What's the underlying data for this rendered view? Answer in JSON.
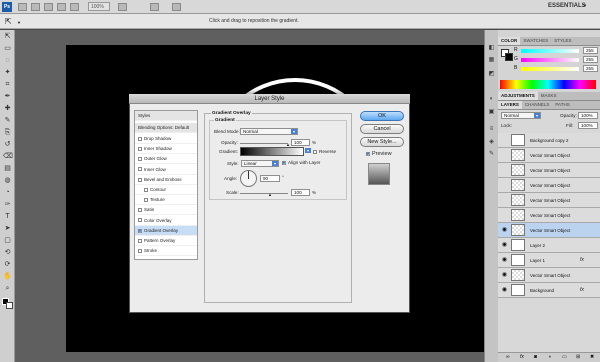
{
  "app": {
    "logo": "Ps",
    "zoom": "100%",
    "workspace": "ESSENTIALS",
    "options_hint": "Click and drag to reposition the gradient."
  },
  "tools": {
    "icons": [
      "move-icon",
      "marquee-icon",
      "lasso-icon",
      "magic-wand-icon",
      "crop-icon",
      "eyedropper-icon",
      "healing-icon",
      "brush-icon",
      "stamp-icon",
      "history-brush-icon",
      "eraser-icon",
      "gradient-icon",
      "blur-icon",
      "dodge-icon",
      "pen-icon",
      "type-icon",
      "path-select-icon",
      "shape-icon",
      "3d-rotate-icon",
      "3d-orbit-icon",
      "hand-icon",
      "zoom-icon"
    ]
  },
  "panels": {
    "color_tabs": [
      "COLOR",
      "SWATCHES",
      "STYLES"
    ],
    "color_labels": [
      "R",
      "G",
      "B"
    ],
    "color_values": [
      "255",
      "255",
      "255"
    ],
    "adjust_tabs": [
      "ADJUSTMENTS",
      "MASKS"
    ],
    "layers_tabs": [
      "LAYERS",
      "CHANNELS",
      "PATHS"
    ],
    "blend_mode": "Normal",
    "opacity_label": "Opacity:",
    "opacity": "100%",
    "lock_label": "Lock:",
    "fill_label": "Fill:",
    "fill": "100%",
    "layers": [
      {
        "name": "Background copy 2",
        "selected": false,
        "fx": false
      },
      {
        "name": "Vector Smart Object",
        "selected": false,
        "fx": false
      },
      {
        "name": "Vector Smart Object",
        "selected": false,
        "fx": false
      },
      {
        "name": "Vector Smart Object",
        "selected": false,
        "fx": false
      },
      {
        "name": "Vector Smart Object",
        "selected": false,
        "fx": false
      },
      {
        "name": "Vector Smart Object",
        "selected": false,
        "fx": false
      },
      {
        "name": "Vector Smart Object",
        "selected": true,
        "fx": false
      },
      {
        "name": "Layer 2",
        "selected": false,
        "fx": false
      },
      {
        "name": "Layer 1",
        "selected": false,
        "fx": true
      },
      {
        "name": "Vector Smart Object",
        "selected": false,
        "fx": false
      },
      {
        "name": "Background",
        "selected": false,
        "fx": true
      }
    ],
    "fx_label": "fx"
  },
  "dialog": {
    "title": "Layer Style",
    "styles_header": "Styles",
    "blending_options": "Blending Options: Default",
    "style_items": [
      {
        "label": "Drop Shadow",
        "checked": false,
        "sub": false
      },
      {
        "label": "Inner Shadow",
        "checked": false,
        "sub": false
      },
      {
        "label": "Outer Glow",
        "checked": false,
        "sub": false
      },
      {
        "label": "Inner Glow",
        "checked": false,
        "sub": false
      },
      {
        "label": "Bevel and Emboss",
        "checked": false,
        "sub": false
      },
      {
        "label": "Contour",
        "checked": false,
        "sub": true
      },
      {
        "label": "Texture",
        "checked": false,
        "sub": true
      },
      {
        "label": "Satin",
        "checked": false,
        "sub": false
      },
      {
        "label": "Color Overlay",
        "checked": false,
        "sub": false
      },
      {
        "label": "Gradient Overlay",
        "checked": true,
        "sub": false
      },
      {
        "label": "Pattern Overlay",
        "checked": false,
        "sub": false
      },
      {
        "label": "Stroke",
        "checked": false,
        "sub": false
      }
    ],
    "section_title": "Gradient Overlay",
    "group_title": "Gradient",
    "blend_mode_label": "Blend Mode:",
    "blend_mode": "Normal",
    "opacity_label": "Opacity:",
    "opacity": "100",
    "percent": "%",
    "gradient_label": "Gradient:",
    "reverse_label": "Reverse",
    "style_label": "Style:",
    "style": "Linear",
    "align_label": "Align with Layer",
    "angle_label": "Angle:",
    "angle": "90",
    "degree": "°",
    "scale_label": "Scale:",
    "scale": "100",
    "ok": "OK",
    "cancel": "Cancel",
    "new_style": "New Style...",
    "preview_label": "Preview"
  }
}
